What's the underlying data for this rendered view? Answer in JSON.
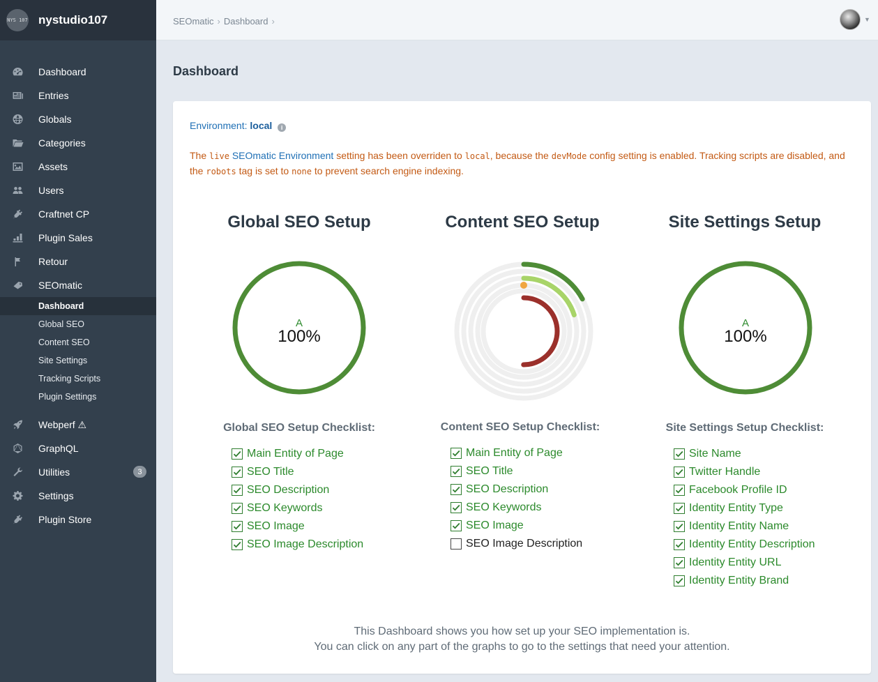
{
  "site": {
    "logo_text": "NYS 107",
    "name": "nystudio107"
  },
  "nav": {
    "items": [
      {
        "label": "Dashboard",
        "icon": "gauge-icon"
      },
      {
        "label": "Entries",
        "icon": "newspaper-icon"
      },
      {
        "label": "Globals",
        "icon": "globe-icon"
      },
      {
        "label": "Categories",
        "icon": "folder-icon"
      },
      {
        "label": "Assets",
        "icon": "image-icon"
      },
      {
        "label": "Users",
        "icon": "users-icon"
      },
      {
        "label": "Craftnet CP",
        "icon": "plug-icon"
      },
      {
        "label": "Plugin Sales",
        "icon": "bar-chart-icon"
      },
      {
        "label": "Retour",
        "icon": "flag-icon"
      },
      {
        "label": "SEOmatic",
        "icon": "seomatic-icon"
      }
    ],
    "seomatic_sub": [
      {
        "label": "Dashboard",
        "active": true
      },
      {
        "label": "Global SEO",
        "active": false
      },
      {
        "label": "Content SEO",
        "active": false
      },
      {
        "label": "Site Settings",
        "active": false
      },
      {
        "label": "Tracking Scripts",
        "active": false
      },
      {
        "label": "Plugin Settings",
        "active": false
      }
    ],
    "bottom_items": [
      {
        "label": "Webperf ⚠",
        "icon": "rocket-icon"
      },
      {
        "label": "GraphQL",
        "icon": "graphql-icon"
      },
      {
        "label": "Utilities",
        "icon": "wrench-icon",
        "badge": "3"
      },
      {
        "label": "Settings",
        "icon": "gear-icon"
      },
      {
        "label": "Plugin Store",
        "icon": "plug-icon"
      }
    ]
  },
  "header": {
    "breadcrumb": [
      "SEOmatic",
      "Dashboard"
    ],
    "separator": "›"
  },
  "page": {
    "title": "Dashboard"
  },
  "environment": {
    "label": "Environment:",
    "value": "local",
    "info_icon": "info-icon"
  },
  "warning": {
    "p1": "The ",
    "code1": "live",
    "p2": " ",
    "link": "SEOmatic Environment",
    "p3": " setting has been overriden to ",
    "code2": "local",
    "p4": ", because the ",
    "code3": "devMode",
    "p5": " config setting is enabled. Tracking scripts are disabled, and the ",
    "code4": "robots",
    "p6": " tag is set to ",
    "code5": "none",
    "p7": " to prevent search engine indexing."
  },
  "sections": {
    "global": {
      "title": "Global SEO Setup",
      "grade": "A",
      "percent": "100%",
      "fill": 1.0,
      "color": "#4e8c36",
      "checklist_title": "Global SEO Setup Checklist:",
      "items": [
        {
          "label": "Main Entity of Page",
          "checked": true
        },
        {
          "label": "SEO Title",
          "checked": true
        },
        {
          "label": "SEO Description",
          "checked": true
        },
        {
          "label": "SEO Keywords",
          "checked": true
        },
        {
          "label": "SEO Image",
          "checked": true
        },
        {
          "label": "SEO Image Description",
          "checked": true
        }
      ]
    },
    "content": {
      "title": "Content SEO Setup",
      "rings": [
        {
          "fill": 0.17,
          "color": "#4e8c36"
        },
        {
          "fill": 0.2,
          "color": "#a8d468"
        },
        {
          "fill": 0.0,
          "color": "#f0a640"
        },
        {
          "fill": 0.5,
          "color": "#9b302b"
        }
      ],
      "checklist_title": "Content SEO Setup Checklist:",
      "items": [
        {
          "label": "Main Entity of Page",
          "checked": true
        },
        {
          "label": "SEO Title",
          "checked": true
        },
        {
          "label": "SEO Description",
          "checked": true
        },
        {
          "label": "SEO Keywords",
          "checked": true
        },
        {
          "label": "SEO Image",
          "checked": true
        },
        {
          "label": "SEO Image Description",
          "checked": false
        }
      ]
    },
    "site": {
      "title": "Site Settings Setup",
      "grade": "A",
      "percent": "100%",
      "fill": 1.0,
      "color": "#4e8c36",
      "checklist_title": "Site Settings Setup Checklist:",
      "items": [
        {
          "label": "Site Name",
          "checked": true
        },
        {
          "label": "Twitter Handle",
          "checked": true
        },
        {
          "label": "Facebook Profile ID",
          "checked": true
        },
        {
          "label": "Identity Entity Type",
          "checked": true
        },
        {
          "label": "Identity Entity Name",
          "checked": true
        },
        {
          "label": "Identity Entity Description",
          "checked": true
        },
        {
          "label": "Identity Entity URL",
          "checked": true
        },
        {
          "label": "Identity Entity Brand",
          "checked": true
        }
      ]
    }
  },
  "footer": {
    "line1": "This Dashboard shows you how set up your SEO implementation is.",
    "line2": "You can click on any part of the graphs to go to the settings that need your attention."
  }
}
